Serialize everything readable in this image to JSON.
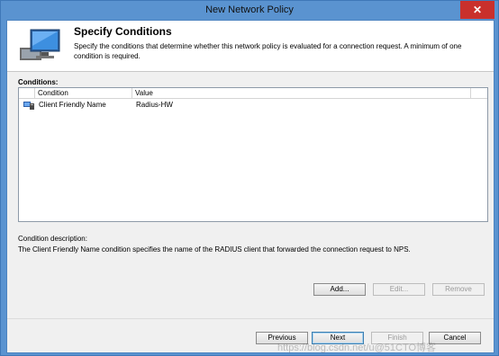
{
  "window": {
    "title": "New Network Policy",
    "close_glyph": "✕"
  },
  "header": {
    "title": "Specify Conditions",
    "description": "Specify the conditions that determine whether this network policy is evaluated for a connection request. A minimum of one condition is required."
  },
  "conditions": {
    "label": "Conditions:",
    "columns": [
      "Condition",
      "Value"
    ],
    "rows": [
      {
        "condition": "Client Friendly Name",
        "value": "Radius-HW",
        "icon": "client-icon"
      }
    ]
  },
  "description": {
    "label": "Condition description:",
    "text": "The Client Friendly Name condition specifies the name of the RADIUS client that forwarded the connection request to NPS."
  },
  "actions": {
    "add": "Add...",
    "edit": "Edit...",
    "remove": "Remove"
  },
  "nav": {
    "previous": "Previous",
    "next": "Next",
    "finish": "Finish",
    "cancel": "Cancel"
  },
  "watermark": "https://blog.csdn.net/u@51CTO博客"
}
